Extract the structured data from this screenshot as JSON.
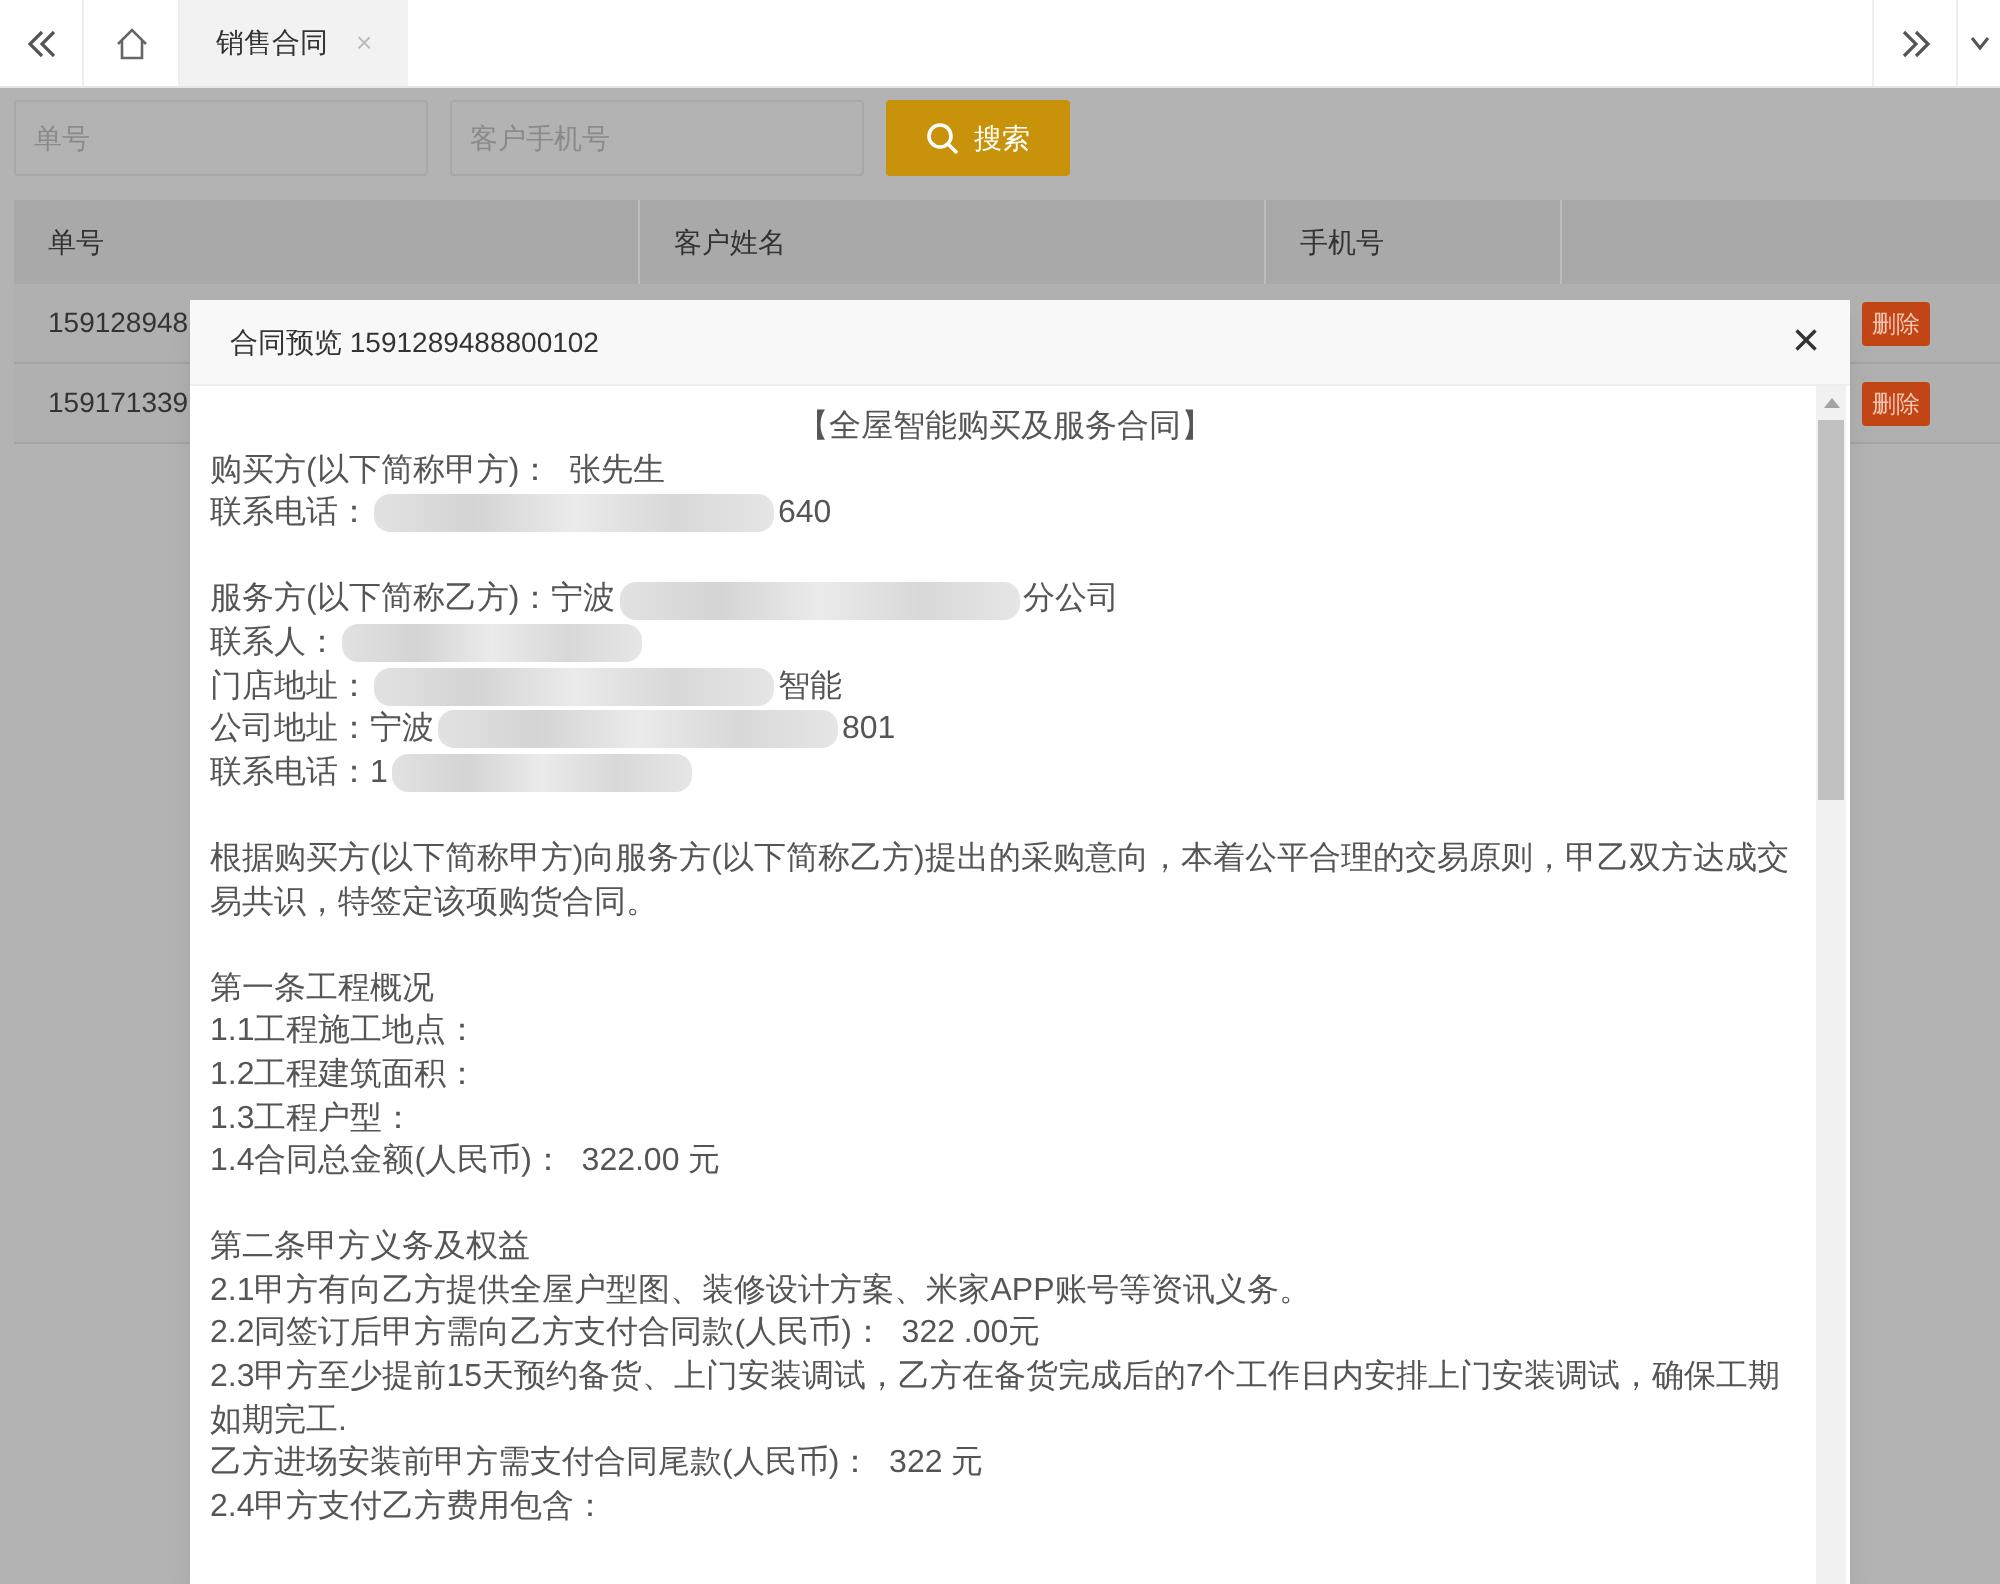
{
  "tabs": [
    {
      "label": "销售合同",
      "selected": true,
      "closable": "×"
    }
  ],
  "search": {
    "fields": [
      {
        "placeholder": "单号"
      },
      {
        "placeholder": "客户手机号"
      }
    ],
    "button": "搜索"
  },
  "table": {
    "columns": [
      "单号",
      "客户姓名",
      "手机号"
    ],
    "rows": [
      {
        "order_no": "159128948",
        "action": "删除"
      },
      {
        "order_no": "159171339",
        "action": "删除"
      }
    ]
  },
  "modal": {
    "title": "合同预览 1591289488800102",
    "close": "×",
    "heading": "【全屋智能购买及服务合同】",
    "lines": [
      {
        "kind": "text",
        "text": "购买方(以下简称甲方)：  张先生"
      },
      {
        "kind": "redacted",
        "before": "联系电话：",
        "after": "640"
      },
      {
        "kind": "blank"
      },
      {
        "kind": "redacted",
        "before": "服务方(以下简称乙方)：宁波",
        "after": "分公司"
      },
      {
        "kind": "redacted",
        "before": "联系人："
      },
      {
        "kind": "redacted",
        "before": "门店地址：",
        "after": "智能"
      },
      {
        "kind": "redacted",
        "before": "公司地址：宁波",
        "after": "801"
      },
      {
        "kind": "redacted",
        "before": "联系电话：1"
      },
      {
        "kind": "blank"
      },
      {
        "kind": "text",
        "text": "根据购买方(以下简称甲方)向服务方(以下简称乙方)提出的采购意向，本着公平合理的交易原则，甲乙双方达成交易共识，特签定该项购货合同。"
      },
      {
        "kind": "blank"
      },
      {
        "kind": "text",
        "text": "第一条工程概况"
      },
      {
        "kind": "text",
        "text": "1.1工程施工地点："
      },
      {
        "kind": "text",
        "text": "1.2工程建筑面积："
      },
      {
        "kind": "text",
        "text": "1.3工程户型："
      },
      {
        "kind": "text",
        "text": "1.4合同总金额(人民币)：  322.00 元"
      },
      {
        "kind": "blank"
      },
      {
        "kind": "text",
        "text": "第二条甲方义务及权益"
      },
      {
        "kind": "text",
        "text": "2.1甲方有向乙方提供全屋户型图、装修设计方案、米家APP账号等资讯义务。"
      },
      {
        "kind": "text",
        "text": "2.2同签订后甲方需向乙方支付合同款(人民币)：  322 .00元"
      },
      {
        "kind": "text",
        "text": "2.3甲方至少提前15天预约备货、上门安装调试，乙方在备货完成后的7个工作日内安排上门安装调试，确保工期如期完工."
      },
      {
        "kind": "text",
        "text": "乙方进场安装前甲方需支付合同尾款(人民币)：  322 元"
      },
      {
        "kind": "text",
        "text": "2.4甲方支付乙方费用包含："
      }
    ]
  }
}
